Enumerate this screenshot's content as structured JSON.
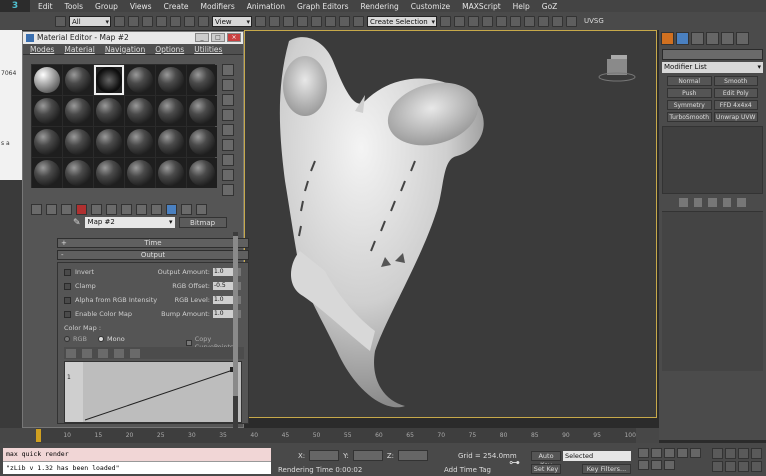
{
  "app": {
    "logo": "3"
  },
  "menubar": {
    "items": [
      "Edit",
      "Tools",
      "Group",
      "Views",
      "Create",
      "Modifiers",
      "Animation",
      "Graph Editors",
      "Rendering",
      "Customize",
      "MAXScript",
      "Help",
      "GoZ"
    ]
  },
  "toolbar": {
    "filter": "All",
    "view": "View",
    "selection_set": "Create Selection Set",
    "uvsg": "UVSG"
  },
  "left_strip": {
    "values": [
      "7064",
      "s a"
    ]
  },
  "command_panel": {
    "modifier_list": "Modifier List",
    "modifiers": [
      "Normal",
      "Smooth",
      "Push",
      "Edit Poly",
      "Symmetry",
      "FFD 4x4x4",
      "TurboSmooth",
      "Unwrap UVW"
    ]
  },
  "material_editor": {
    "title": "Material Editor - Map #2",
    "menus": [
      "Modes",
      "Material",
      "Navigation",
      "Options",
      "Utilities"
    ],
    "map_name": "Map #2",
    "map_type": "Bitmap",
    "rollouts": {
      "time": "Time",
      "output": "Output",
      "time_sign": "+",
      "output_sign": "-"
    },
    "output": {
      "invert": "Invert",
      "clamp": "Clamp",
      "alpha_rgb": "Alpha from RGB Intensity",
      "enable_color_map": "Enable Color Map",
      "output_amount_label": "Output Amount:",
      "output_amount": "1.0",
      "rgb_offset_label": "RGB Offset:",
      "rgb_offset": "-0.5",
      "rgb_level_label": "RGB Level:",
      "rgb_level": "1.0",
      "bump_amount_label": "Bump Amount:",
      "bump_amount": "1.0",
      "color_map_label": "Color Map :",
      "rgb": "RGB",
      "mono": "Mono",
      "copy_curve": "Copy CurvePoints",
      "curve_value": "1"
    }
  },
  "timeline": {
    "ticks": [
      "10",
      "15",
      "20",
      "25",
      "30",
      "35",
      "40",
      "45",
      "50",
      "55",
      "60",
      "65",
      "70",
      "75",
      "80",
      "85",
      "90",
      "95",
      "100"
    ]
  },
  "status": {
    "listener_line1": "max quick render",
    "listener_line2": "\"zLib v 1.32 has been loaded\"",
    "x": "X:",
    "y": "Y:",
    "z": "Z:",
    "grid": "Grid = 254.0mm",
    "rendering_time": "Rendering Time  0:00:02",
    "add_time_tag": "Add Time Tag",
    "auto_key": "Auto Key",
    "set_key": "Set Key",
    "selected": "Selected",
    "key_filters": "Key Filters..."
  }
}
